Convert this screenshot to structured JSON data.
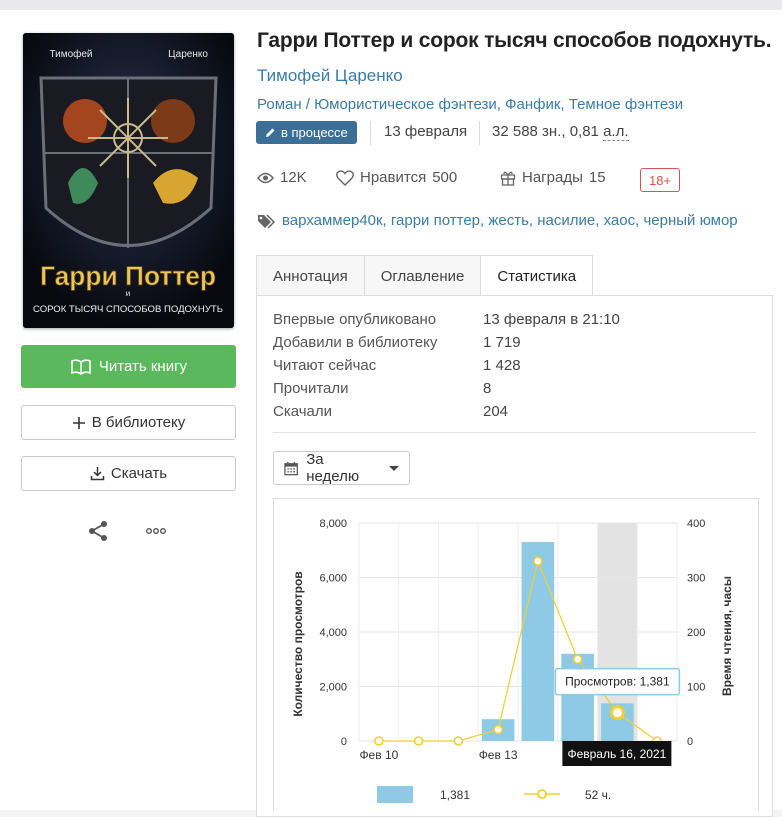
{
  "book": {
    "title": "Гарри Поттер и сорок тысяч способов подохнуть.",
    "author": "Тимофей Царенко",
    "genres": [
      "Роман",
      "Юмористическое фэнтези",
      "Фанфик",
      "Темное фэнтези"
    ],
    "status": "в процессе",
    "date": "13 февраля",
    "size_chars": "32 588 зн., 0,81",
    "size_unit": "а.л.",
    "views": "12K",
    "likes_label": "Нравится",
    "likes": "500",
    "awards_label": "Награды",
    "awards": "15",
    "age_rating": "18+",
    "tags": [
      "вархаммер40к",
      "гарри поттер",
      "жесть",
      "насилие",
      "хаос",
      "черный юмор"
    ]
  },
  "cover": {
    "author_first": "Тимофей",
    "author_last": "Царенко",
    "title_line1": "Гарри Поттер",
    "title_and": "и",
    "title_line2": "сорок тысяч способов подохнуть"
  },
  "actions": {
    "read": "Читать книгу",
    "library": "В библиотеку",
    "download": "Скачать"
  },
  "tabs": [
    "Аннотация",
    "Оглавление",
    "Статистика"
  ],
  "active_tab": "Статистика",
  "stats": [
    {
      "label": "Впервые опубликовано",
      "value": "13 февраля в 21:10"
    },
    {
      "label": "Добавили в библиотеку",
      "value": "1 719"
    },
    {
      "label": "Читают сейчас",
      "value": "1 428"
    },
    {
      "label": "Прочитали",
      "value": "8"
    },
    {
      "label": "Скачали",
      "value": "204"
    }
  ],
  "period_select": "За неделю",
  "chart_data": {
    "type": "bar",
    "categories": [
      "Фев 10",
      "Фев 11",
      "Фев 12",
      "Фев 13",
      "Фев 14",
      "Фев 15",
      "Фев 16",
      "Фев 17"
    ],
    "x_tick_labels": [
      "Фев 10",
      "Фев 13"
    ],
    "series": [
      {
        "name": "",
        "type": "bar",
        "axis": "left",
        "color": "#8ecae6",
        "values": [
          0,
          0,
          0,
          800,
          7300,
          3200,
          1381,
          0
        ]
      },
      {
        "name": "",
        "type": "line",
        "axis": "right",
        "color": "#f1d02b",
        "values": [
          0,
          0,
          0,
          21,
          330,
          150,
          52,
          0
        ]
      }
    ],
    "ylabel": "Количество просмотров",
    "ylabel_right": "Время чтения, часы",
    "ylim": [
      0,
      8000
    ],
    "ylim_right": [
      0,
      400
    ],
    "yticks": [
      "0",
      "2,000",
      "4,000",
      "6,000",
      "8,000"
    ],
    "yticks_right": [
      "0",
      "100",
      "200",
      "300",
      "400"
    ],
    "highlighted_index": 6,
    "tooltip": "Просмотров: 1,381",
    "crosshair_label": "Февраль 16, 2021",
    "legend": [
      "1,381",
      "52 ч."
    ],
    "grid": true
  },
  "colors": {
    "accent_link": "#3a7ca5",
    "read_button": "#5cb85c",
    "status_badge": "#3c6f98",
    "age_badge": "#d9534f"
  }
}
